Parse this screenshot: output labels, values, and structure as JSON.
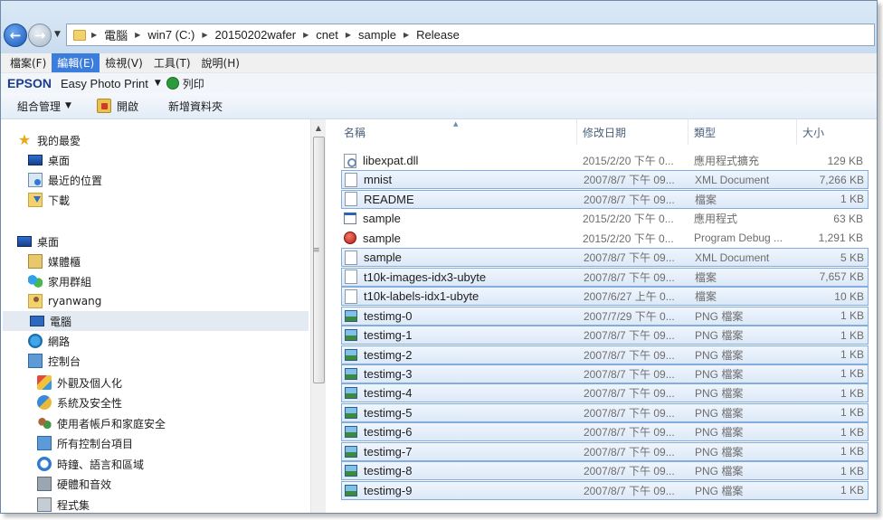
{
  "address": {
    "crumbs": [
      "電腦",
      "win7 (C:)",
      "20150202wafer",
      "cnet",
      "sample",
      "Release"
    ]
  },
  "menu": [
    "檔案(F)",
    "編輯(E)",
    "檢視(V)",
    "工具(T)",
    "說明(H)"
  ],
  "menu_active": "編輯(E)",
  "epson": {
    "logo": "EPSON",
    "app": "Easy Photo Print",
    "print_label": "列印"
  },
  "commands": {
    "organize": "組合管理",
    "open": "開啟",
    "new_folder": "新增資料夾"
  },
  "nav": {
    "favorites": "我的最愛",
    "fav_items": [
      "桌面",
      "最近的位置",
      "下載"
    ],
    "desktop": "桌面",
    "desktop_items": [
      "媒體櫃",
      "家用群組",
      "ryanwang",
      "電腦",
      "網路",
      "控制台"
    ],
    "control_items": [
      "外觀及個人化",
      "系統及安全性",
      "使用者帳戶和家庭安全",
      "所有控制台項目",
      "時鐘、語言和區域",
      "硬體和音效",
      "程式集"
    ],
    "selected": "電腦"
  },
  "columns": {
    "name": "名稱",
    "date": "修改日期",
    "type": "類型",
    "size": "大小"
  },
  "files": [
    {
      "name": "libexpat.dll",
      "date": "2015/2/20 下午 0...",
      "type": "應用程式擴充",
      "size": "129 KB",
      "icon": "dll-icon",
      "selected": false
    },
    {
      "name": "mnist",
      "date": "2007/8/7 下午 09...",
      "type": "XML Document",
      "size": "7,266 KB",
      "icon": "xml-document-icon",
      "selected": true
    },
    {
      "name": "README",
      "date": "2007/8/7 下午 09...",
      "type": "檔案",
      "size": "1 KB",
      "icon": "file-icon",
      "selected": true
    },
    {
      "name": "sample",
      "date": "2015/2/20 下午 0...",
      "type": "應用程式",
      "size": "63 KB",
      "icon": "application-icon",
      "selected": false
    },
    {
      "name": "sample",
      "date": "2015/2/20 下午 0...",
      "type": "Program Debug ...",
      "size": "1,291 KB",
      "icon": "debug-database-icon",
      "selected": false
    },
    {
      "name": "sample",
      "date": "2007/8/7 下午 09...",
      "type": "XML Document",
      "size": "5 KB",
      "icon": "xml-document-icon",
      "selected": true
    },
    {
      "name": "t10k-images-idx3-ubyte",
      "date": "2007/8/7 下午 09...",
      "type": "檔案",
      "size": "7,657 KB",
      "icon": "file-icon",
      "selected": true
    },
    {
      "name": "t10k-labels-idx1-ubyte",
      "date": "2007/6/27 上午 0...",
      "type": "檔案",
      "size": "10 KB",
      "icon": "file-icon",
      "selected": true
    },
    {
      "name": "testimg-0",
      "date": "2007/7/29 下午 0...",
      "type": "PNG 檔案",
      "size": "1 KB",
      "icon": "png-image-icon",
      "selected": true
    },
    {
      "name": "testimg-1",
      "date": "2007/8/7 下午 09...",
      "type": "PNG 檔案",
      "size": "1 KB",
      "icon": "png-image-icon",
      "selected": true
    },
    {
      "name": "testimg-2",
      "date": "2007/8/7 下午 09...",
      "type": "PNG 檔案",
      "size": "1 KB",
      "icon": "png-image-icon",
      "selected": true
    },
    {
      "name": "testimg-3",
      "date": "2007/8/7 下午 09...",
      "type": "PNG 檔案",
      "size": "1 KB",
      "icon": "png-image-icon",
      "selected": true
    },
    {
      "name": "testimg-4",
      "date": "2007/8/7 下午 09...",
      "type": "PNG 檔案",
      "size": "1 KB",
      "icon": "png-image-icon",
      "selected": true
    },
    {
      "name": "testimg-5",
      "date": "2007/8/7 下午 09...",
      "type": "PNG 檔案",
      "size": "1 KB",
      "icon": "png-image-icon",
      "selected": true
    },
    {
      "name": "testimg-6",
      "date": "2007/8/7 下午 09...",
      "type": "PNG 檔案",
      "size": "1 KB",
      "icon": "png-image-icon",
      "selected": true
    },
    {
      "name": "testimg-7",
      "date": "2007/8/7 下午 09...",
      "type": "PNG 檔案",
      "size": "1 KB",
      "icon": "png-image-icon",
      "selected": true
    },
    {
      "name": "testimg-8",
      "date": "2007/8/7 下午 09...",
      "type": "PNG 檔案",
      "size": "1 KB",
      "icon": "png-image-icon",
      "selected": true
    },
    {
      "name": "testimg-9",
      "date": "2007/8/7 下午 09...",
      "type": "PNG 檔案",
      "size": "1 KB",
      "icon": "png-image-icon",
      "selected": true
    }
  ],
  "colors": {
    "selection_fill": "#dde9f8",
    "selection_border": "#84acdd",
    "menu_highlight": "#3b7ddd",
    "epson_blue": "#1a3c8c"
  }
}
